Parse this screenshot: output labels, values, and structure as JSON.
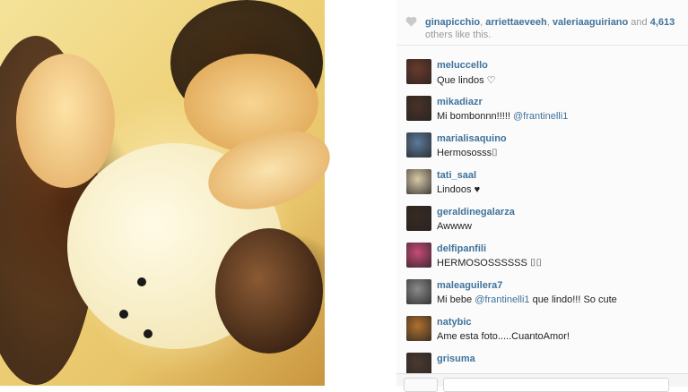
{
  "photo": {
    "alt": ""
  },
  "likes": {
    "users": [
      "ginapicchio",
      "arriettaeveeh",
      "valeriaaguiriano"
    ],
    "sep1": ", ",
    "sep2": ", ",
    "and_text": " and ",
    "count": "4,613",
    "suffix": "others like this."
  },
  "comments": [
    {
      "user": "meluccello",
      "text": "Que lindos ♡",
      "mention": "",
      "text_after": "",
      "avatar_color": "#6b3a2c"
    },
    {
      "user": "mikadiazr",
      "text": "Mi bombonnn!!!!! ",
      "mention": "@frantinelli1",
      "text_after": "",
      "avatar_color": "#4a3226"
    },
    {
      "user": "marialisaquino",
      "text": "Hermososss⌷",
      "mention": "",
      "text_after": "",
      "avatar_color": "#5c7a9a"
    },
    {
      "user": "tati_saal",
      "text": "Lindoos ♥",
      "mention": "",
      "text_after": "",
      "avatar_color": "#d8c9a8"
    },
    {
      "user": "geraldinegalarza",
      "text": "Awwww",
      "mention": "",
      "text_after": "",
      "avatar_color": "#3a2a22"
    },
    {
      "user": "delfipanfili",
      "text": "HERMOSOSSSSSS ⌷⌷",
      "mention": "",
      "text_after": "",
      "avatar_color": "#c84a78"
    },
    {
      "user": "maleaguilera7",
      "text": "Mi bebe ",
      "mention": "@frantinelli1",
      "text_after": " que lindo!!! So cute",
      "avatar_color": "#8a8a8a"
    },
    {
      "user": "natybic",
      "text": "Ame esta foto.....CuantoAmor!",
      "mention": "",
      "text_after": "",
      "avatar_color": "#b0702e"
    },
    {
      "user": "grisuma",
      "text": "",
      "mention": "",
      "text_after": "",
      "avatar_color": "#4b3a30"
    }
  ],
  "colors": {
    "username": "#3f729b",
    "muted": "#999999"
  }
}
